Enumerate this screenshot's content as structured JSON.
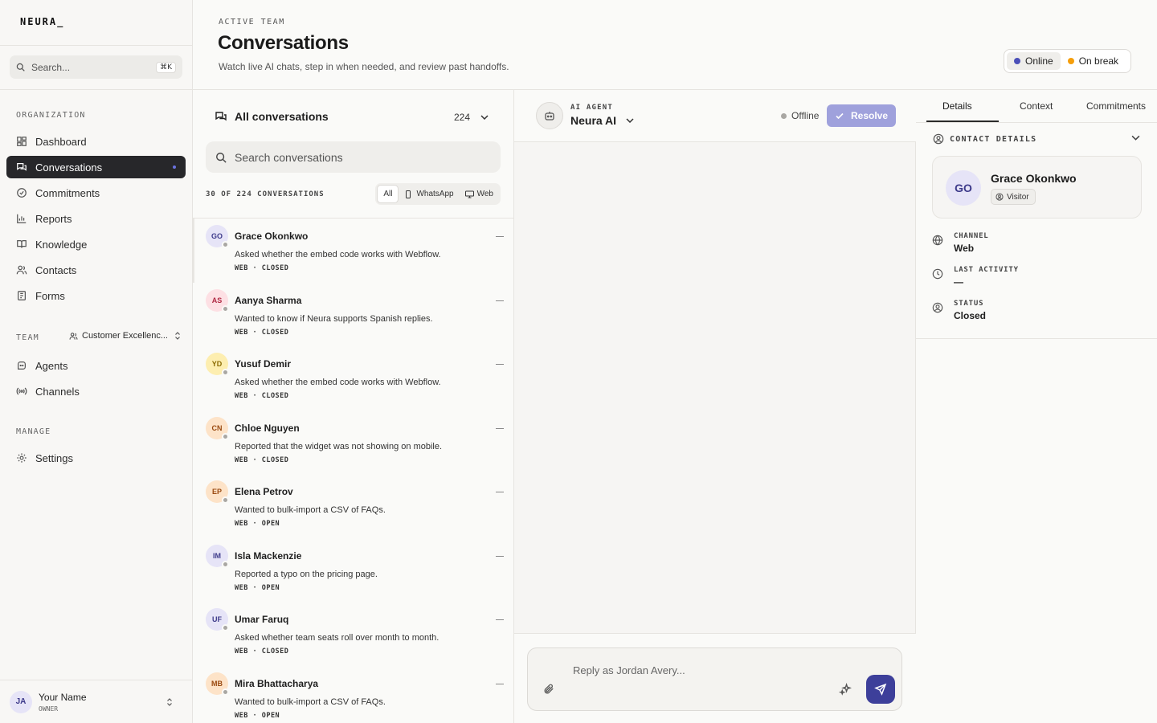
{
  "brand": {
    "logo": "NEURA_"
  },
  "sidebar": {
    "search_placeholder": "Search...",
    "search_shortcut": "⌘K",
    "org_label": "ORGANIZATION",
    "org_items": [
      {
        "label": "Dashboard",
        "icon": "dashboard-icon"
      },
      {
        "label": "Conversations",
        "icon": "chat-icon",
        "active": true
      },
      {
        "label": "Commitments",
        "icon": "check-circle-icon"
      },
      {
        "label": "Reports",
        "icon": "bar-chart-icon"
      },
      {
        "label": "Knowledge",
        "icon": "book-icon"
      },
      {
        "label": "Contacts",
        "icon": "users-icon"
      },
      {
        "label": "Forms",
        "icon": "form-icon"
      }
    ],
    "team_label": "TEAM",
    "team_selector": "Customer Excellenc...",
    "team_items": [
      {
        "label": "Agents",
        "icon": "bot-icon"
      },
      {
        "label": "Channels",
        "icon": "broadcast-icon"
      }
    ],
    "manage_label": "MANAGE",
    "manage_items": [
      {
        "label": "Settings",
        "icon": "gear-icon"
      }
    ],
    "user": {
      "initials": "JA",
      "name": "Your Name",
      "role": "OWNER"
    }
  },
  "header": {
    "eyebrow": "ACTIVE TEAM",
    "title": "Conversations",
    "subtitle": "Watch live AI chats, step in when needed, and review past handoffs.",
    "status_options": [
      {
        "label": "Online",
        "color": "#4b4fb8",
        "active": true
      },
      {
        "label": "On break",
        "color": "#f59e0b",
        "active": false
      }
    ]
  },
  "list": {
    "title": "All conversations",
    "count": "224",
    "search_placeholder": "Search conversations",
    "count_label": "30 OF 224 CONVERSATIONS",
    "filters": [
      {
        "label": "All",
        "active": true
      },
      {
        "label": "WhatsApp",
        "icon": "phone-icon"
      },
      {
        "label": "Web",
        "icon": "monitor-icon"
      }
    ],
    "conversations": [
      {
        "initials": "GO",
        "name": "Grace Okonkwo",
        "message": "Asked whether the embed code works with Webflow.",
        "meta": "WEB · CLOSED",
        "avatar_bg": "#e6e4f7",
        "avatar_fg": "#3d3a8a"
      },
      {
        "initials": "AS",
        "name": "Aanya Sharma",
        "message": "Wanted to know if Neura supports Spanish replies.",
        "meta": "WEB · CLOSED",
        "avatar_bg": "#fde0e4",
        "avatar_fg": "#b02a44"
      },
      {
        "initials": "YD",
        "name": "Yusuf Demir",
        "message": "Asked whether the embed code works with Webflow.",
        "meta": "WEB · CLOSED",
        "avatar_bg": "#fdeeb0",
        "avatar_fg": "#8a6a00"
      },
      {
        "initials": "CN",
        "name": "Chloe Nguyen",
        "message": "Reported that the widget was not showing on mobile.",
        "meta": "WEB · CLOSED",
        "avatar_bg": "#fde3c8",
        "avatar_fg": "#9a4a10"
      },
      {
        "initials": "EP",
        "name": "Elena Petrov",
        "message": "Wanted to bulk-import a CSV of FAQs.",
        "meta": "WEB · OPEN",
        "avatar_bg": "#fde3c8",
        "avatar_fg": "#9a4a10"
      },
      {
        "initials": "IM",
        "name": "Isla Mackenzie",
        "message": "Reported a typo on the pricing page.",
        "meta": "WEB · OPEN",
        "avatar_bg": "#e6e4f7",
        "avatar_fg": "#3d3a8a"
      },
      {
        "initials": "UF",
        "name": "Umar Faruq",
        "message": "Asked whether team seats roll over month to month.",
        "meta": "WEB · CLOSED",
        "avatar_bg": "#e6e4f7",
        "avatar_fg": "#3d3a8a"
      },
      {
        "initials": "MB",
        "name": "Mira Bhattacharya",
        "message": "Wanted to bulk-import a CSV of FAQs.",
        "meta": "WEB · OPEN",
        "avatar_bg": "#fde3c8",
        "avatar_fg": "#9a4a10"
      }
    ]
  },
  "chat": {
    "agent_label": "AI AGENT",
    "agent_name": "Neura AI",
    "status": "Offline",
    "resolve_label": "Resolve",
    "reply_placeholder": "Reply as Jordan Avery..."
  },
  "details": {
    "tabs": [
      "Details",
      "Context",
      "Commitments"
    ],
    "section_title": "CONTACT DETAILS",
    "contact": {
      "initials": "GO",
      "name": "Grace Okonkwo",
      "badge": "Visitor"
    },
    "rows": [
      {
        "label": "CHANNEL",
        "value": "Web",
        "icon": "globe-icon"
      },
      {
        "label": "LAST ACTIVITY",
        "value": "—",
        "icon": "clock-icon"
      },
      {
        "label": "STATUS",
        "value": "Closed",
        "icon": "user-circle-icon"
      }
    ]
  }
}
